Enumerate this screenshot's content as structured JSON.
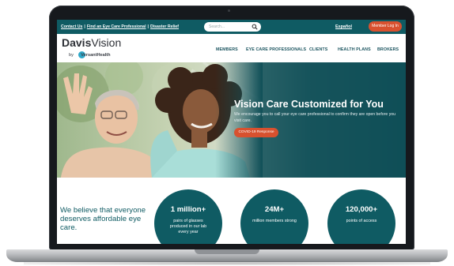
{
  "utility_bar": {
    "links": [
      "Contact Us",
      "Find an Eye Care Professional",
      "Disaster Relief"
    ],
    "search_placeholder": "Search...",
    "language": "Español",
    "member_login": "Member Log In"
  },
  "header": {
    "logo_davis": "Davis",
    "logo_vision": "Vision",
    "logo_by": "by",
    "logo_versant": "VersantHealth",
    "nav": [
      "MEMBERS",
      "EYE CARE PROFESSIONALS",
      "CLIENTS",
      "HEALTH PLANS",
      "BROKERS"
    ]
  },
  "hero": {
    "title": "Vision Care Customized for You",
    "description": "We encourage you to call your eye care professional to confirm they are open before you visit care.",
    "cta": "COVID-19 Response"
  },
  "stats": {
    "tagline": "We believe that everyone deserves affordable eye care.",
    "items": [
      {
        "value": "1 million+",
        "label": "pairs of glasses produced in our lab every year"
      },
      {
        "value": "24M+",
        "label": "million members strong"
      },
      {
        "value": "120,000+",
        "label": "points of access"
      }
    ]
  },
  "colors": {
    "teal": "#0f5b63",
    "accent": "#d8512f",
    "dark": "#16191d"
  },
  "icons": [
    "search-icon"
  ]
}
